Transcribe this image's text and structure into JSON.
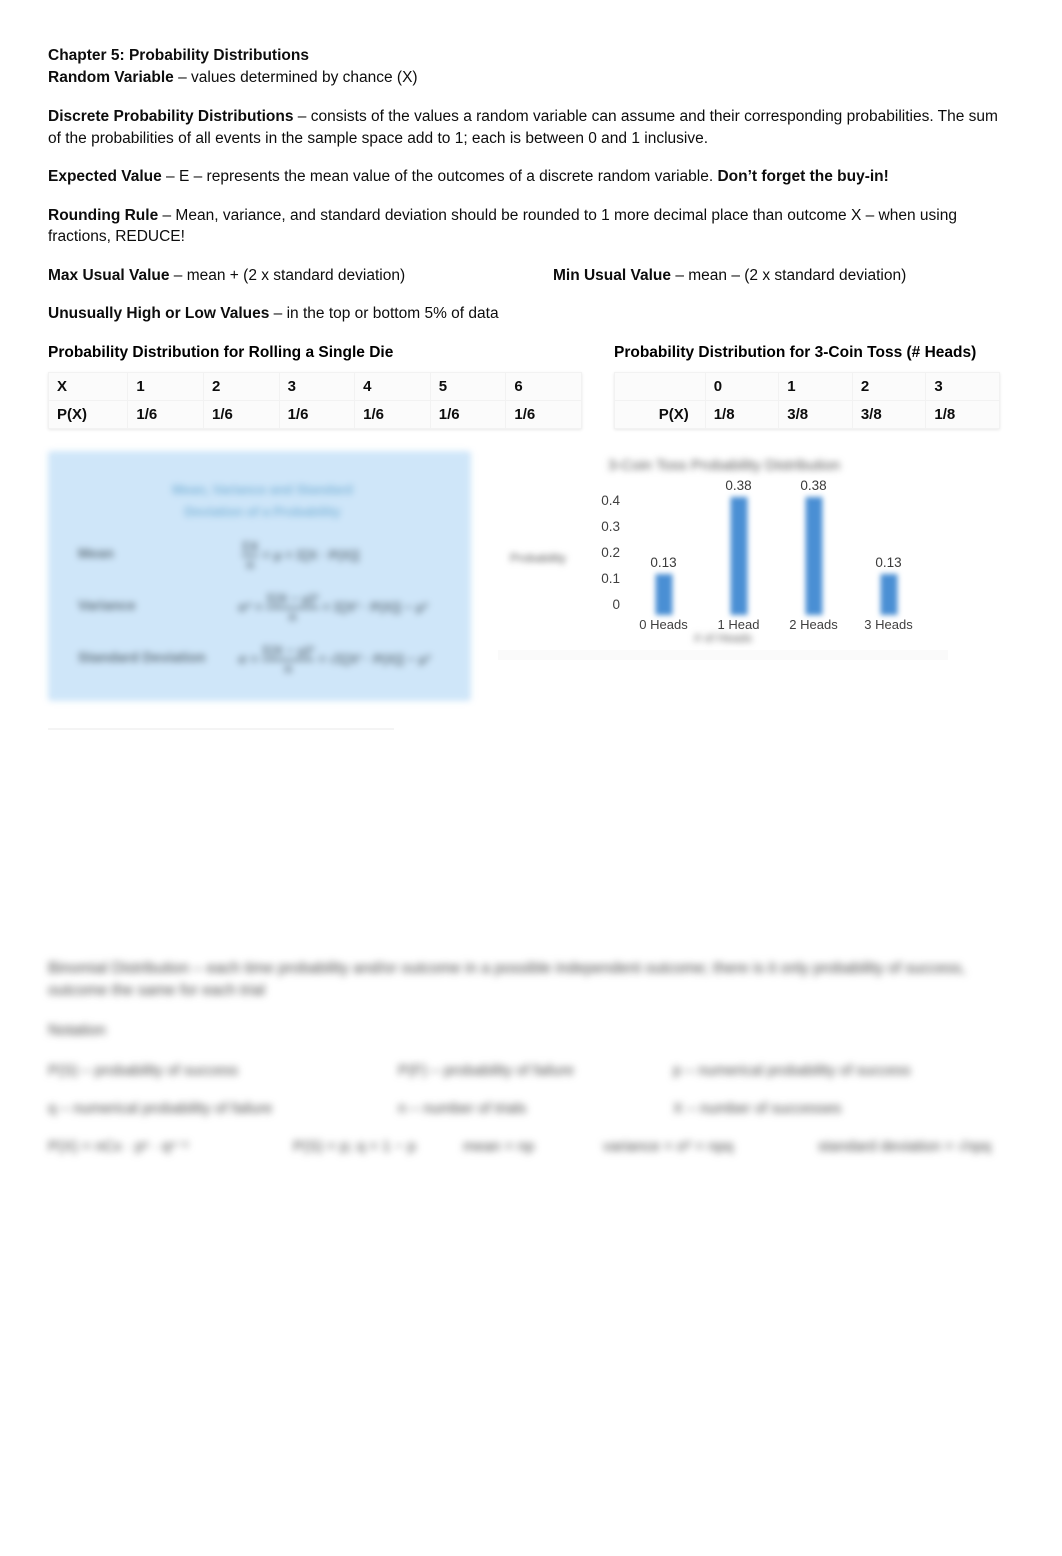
{
  "document": {
    "heading": {
      "chapter_title": "Chapter 5:  Probability Distributions",
      "random_variable_term": "Random Variable",
      "random_variable_def": " – values determined by chance (X)"
    },
    "definitions": [
      {
        "term": "Discrete Probability Distributions",
        "body": " – consists of the values a random variable can assume and their corresponding probabilities. The sum of the probabilities of all events in the sample space add to 1; each is between 0 and 1 inclusive."
      },
      {
        "term": "Expected Value",
        "body": " – E – represents the mean value of the outcomes of a discrete random variable. ",
        "emphasis": "Don’t forget the buy-in!"
      },
      {
        "term": "Rounding Rule",
        "body": " – Mean, variance, and standard deviation should be rounded to 1 more decimal place than outcome X – when using fractions, REDUCE!"
      }
    ],
    "usual_values": {
      "max_term": "Max Usual Value",
      "max_body": " – mean + (2 x standard deviation)",
      "min_term": "Min Usual Value",
      "min_body": " – mean – (2 x standard deviation)"
    },
    "unusual": {
      "term": "Unusually High or Low Values",
      "body": " – in the top or bottom 5% of data"
    },
    "captions": {
      "die": "Probability Distribution for Rolling a Single Die",
      "coin": "Probability Distribution for 3-Coin Toss (# Heads)"
    },
    "die_table": {
      "row_labels": [
        "X",
        "P(X)"
      ],
      "x_values": [
        "1",
        "2",
        "3",
        "4",
        "5",
        "6"
      ],
      "p_values": [
        "1/6",
        "1/6",
        "1/6",
        "1/6",
        "1/6",
        "1/6"
      ]
    },
    "coin_table": {
      "row_labels": [
        "",
        "P(X)"
      ],
      "x_values": [
        "0",
        "1",
        "2",
        "3"
      ],
      "p_values": [
        "1/8",
        "3/8",
        "3/8",
        "1/8"
      ]
    },
    "formula_card": {
      "title_line1": "Mean, Variance and Standard",
      "title_line2": "Deviation of a Probability",
      "rows": [
        {
          "label": "Mean",
          "formula_num": "ΣX",
          "formula_den": "n",
          "formula_tail": "= μ = Σ[X · P(X)]"
        },
        {
          "label": "Variance",
          "formula_lead": "σ² =",
          "formula_num": "Σ(X − μ)²",
          "formula_den": "n",
          "formula_tail": "= Σ[X² · P(X)] − μ²"
        },
        {
          "label": "Standard Deviation",
          "formula_lead": "σ =",
          "formula_num": "Σ(X − μ)²",
          "formula_den": "n",
          "formula_tail": "= √Σ[X² · P(X)] − μ²"
        }
      ],
      "background_color": "#cfe6f9"
    },
    "blurred_bottom": {
      "paragraph": "Binomial Distribution – each time probability and/or outcome in a possible independent outcome; there is it only probability of success, outcome the same for each trial",
      "label": "Notation",
      "grid": [
        [
          "P(S) – probability of success",
          "P(F) – probability of failure",
          "p – numerical probability of success"
        ],
        [
          "q – numerical probability of failure",
          "n – number of trials",
          "X – number of successes"
        ]
      ],
      "formula_row": [
        "P(X) = nCx · pˣ · qⁿ⁻ˣ",
        "P(S) = p;  q = 1 − p",
        "mean = np",
        "variance = σ² = npq",
        "standard deviation = √npq"
      ]
    },
    "accent_color": "#4a8fd4"
  },
  "chart_data": {
    "type": "bar",
    "title": "3-Coin Toss Probability Distribution",
    "title_legible": false,
    "categories": [
      "0 Heads",
      "1 Head",
      "2 Heads",
      "3 Heads"
    ],
    "values": [
      0.13,
      0.38,
      0.38,
      0.13
    ],
    "data_labels": [
      "0.13",
      "0.38",
      "0.38",
      "0.13"
    ],
    "xlabel": "# of Heads",
    "ylabel": "Probability",
    "axis_labels_legible": false,
    "ytick_labels": [
      "0.4",
      "0.3",
      "0.2",
      "0.1",
      "0"
    ],
    "ytick_values": [
      0.4,
      0.3,
      0.2,
      0.1,
      0
    ],
    "ylim": [
      0,
      0.4
    ],
    "grid": false,
    "legend": false,
    "bar_color": "#4a8fd4"
  }
}
